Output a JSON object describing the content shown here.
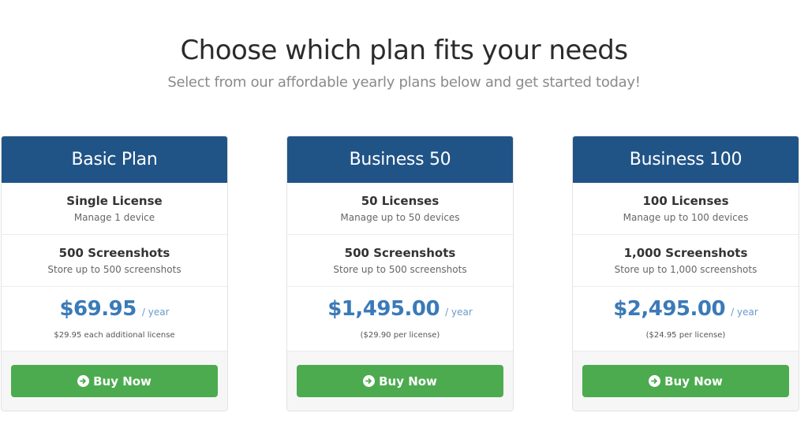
{
  "header": {
    "title": "Choose which plan fits your needs",
    "subtitle": "Select from our affordable yearly plans below and get started today!"
  },
  "colors": {
    "header_bg": "#205487",
    "price": "#3a7ab8",
    "button": "#4cab4f"
  },
  "plans": [
    {
      "name": "Basic Plan",
      "licenses_title": "Single License",
      "licenses_sub": "Manage 1 device",
      "screenshots_title": "500 Screenshots",
      "screenshots_sub": "Store up to 500 screenshots",
      "price": "$69.95",
      "period": "/ year",
      "note": "$29.95 each additional license",
      "button_label": "Buy Now",
      "button_icon": "arrow-circle-right-icon"
    },
    {
      "name": "Business 50",
      "licenses_title": "50 Licenses",
      "licenses_sub": "Manage up to 50 devices",
      "screenshots_title": "500 Screenshots",
      "screenshots_sub": "Store up to 500 screenshots",
      "price": "$1,495.00",
      "period": "/ year",
      "note": "($29.90 per license)",
      "button_label": "Buy Now",
      "button_icon": "arrow-circle-right-icon"
    },
    {
      "name": "Business 100",
      "licenses_title": "100 Licenses",
      "licenses_sub": "Manage up to 100 devices",
      "screenshots_title": "1,000 Screenshots",
      "screenshots_sub": "Store up to 1,000 screenshots",
      "price": "$2,495.00",
      "period": "/ year",
      "note": "($24.95 per license)",
      "button_label": "Buy Now",
      "button_icon": "arrow-circle-right-icon"
    }
  ]
}
